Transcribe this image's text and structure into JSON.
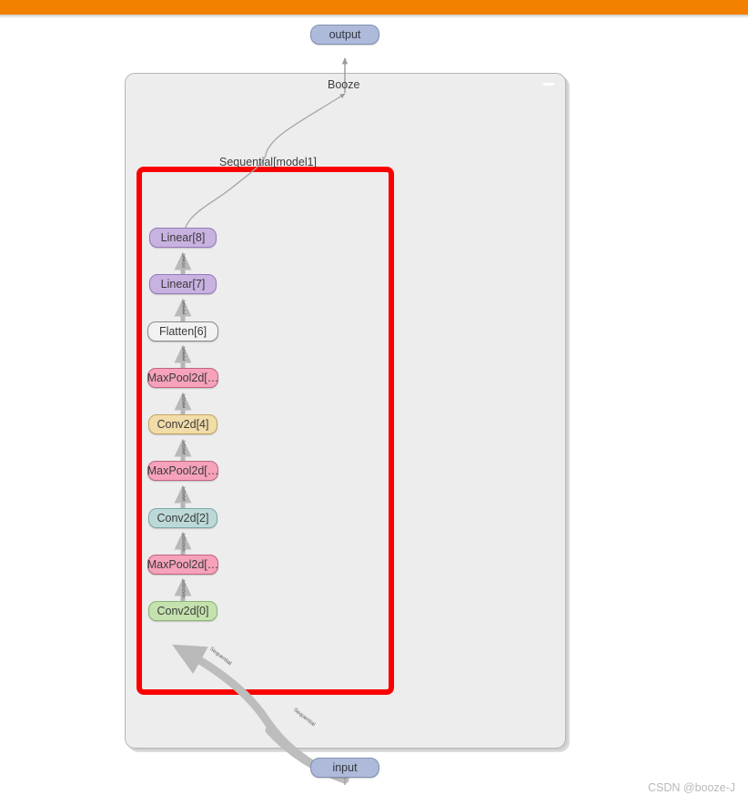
{
  "window": {
    "title_bar_color": "#f28100",
    "background_color": "#ffffff"
  },
  "diagram": {
    "type": "neural-network-architecture-graph",
    "framework_hint": "torchviz/hiddenlayer style module graph",
    "highlight_box": {
      "color": "#fb0000",
      "label": "highlighted-sequential-block"
    },
    "cluster_labels": [
      {
        "id": "booze",
        "text": "Booze"
      },
      {
        "id": "sequential",
        "text": "Sequential[model1]"
      }
    ],
    "io_nodes": [
      {
        "id": "output",
        "label": "output",
        "color": "#aebada"
      },
      {
        "id": "input",
        "label": "input",
        "color": "#aebada"
      }
    ],
    "layers": [
      {
        "id": "linear8",
        "label": "Linear[8]",
        "kind": "linear",
        "color": "#c8b2e0"
      },
      {
        "id": "linear7",
        "label": "Linear[7]",
        "kind": "linear",
        "color": "#c8b2e0"
      },
      {
        "id": "flatten6",
        "label": "Flatten[6]",
        "kind": "flatten",
        "color": "#f2f2f2"
      },
      {
        "id": "maxpool5",
        "label": "MaxPool2d[…",
        "kind": "maxpool",
        "color": "#f5a2ba"
      },
      {
        "id": "conv4",
        "label": "Conv2d[4]",
        "kind": "conv-tan",
        "color": "#f2dca8"
      },
      {
        "id": "maxpool3",
        "label": "MaxPool2d[…",
        "kind": "maxpool",
        "color": "#f5a2ba"
      },
      {
        "id": "conv2",
        "label": "Conv2d[2]",
        "kind": "conv-blue",
        "color": "#bcd9d8"
      },
      {
        "id": "maxpool1",
        "label": "MaxPool2d[…",
        "kind": "maxpool",
        "color": "#f5a2ba"
      },
      {
        "id": "conv0",
        "label": "Conv2d[0]",
        "kind": "conv-green",
        "color": "#c5e2ae"
      }
    ],
    "edge_tensor_labels": [
      "1x64x1x1",
      "1x64x4x4",
      "1x64x4x4",
      "1x32x4x4",
      "1x32x8x8",
      "1x32x8x8",
      "1x32x16x16",
      "1x32x16x16"
    ],
    "curved_edge_labels": [
      "Sequential",
      "Sequential"
    ]
  },
  "watermark": {
    "text": "CSDN @booze-J"
  }
}
